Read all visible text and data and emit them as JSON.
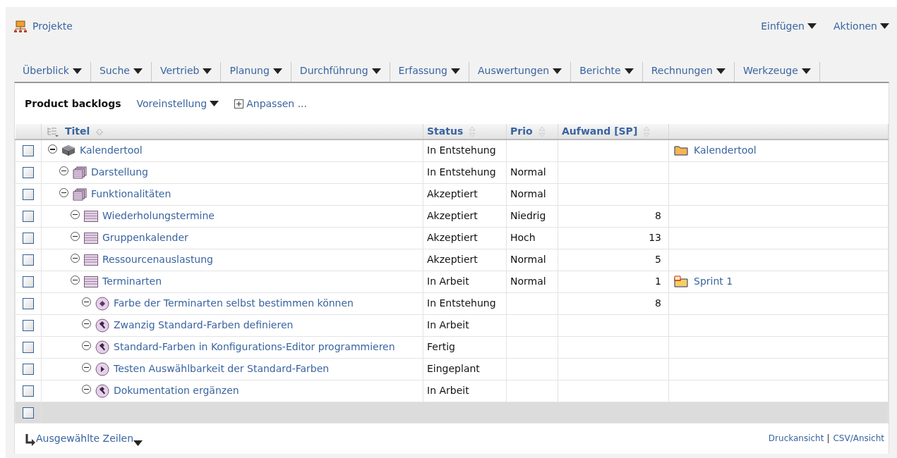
{
  "breadcrumb": {
    "label": "Projekte"
  },
  "top_actions": [
    {
      "label": "Einfügen"
    },
    {
      "label": "Aktionen"
    }
  ],
  "menu": [
    {
      "label": "Überblick"
    },
    {
      "label": "Suche"
    },
    {
      "label": "Vertrieb"
    },
    {
      "label": "Planung"
    },
    {
      "label": "Durchführung"
    },
    {
      "label": "Erfassung"
    },
    {
      "label": "Auswertungen"
    },
    {
      "label": "Berichte"
    },
    {
      "label": "Rechnungen"
    },
    {
      "label": "Werkzeuge"
    }
  ],
  "view": {
    "title": "Product backlogs",
    "preset": "Voreinstellung",
    "customize": "Anpassen ..."
  },
  "table": {
    "columns": [
      {
        "label": "Titel",
        "sorted": true
      },
      {
        "label": "Status",
        "sorted": false
      },
      {
        "label": "Prio",
        "sorted": false
      },
      {
        "label": "Aufwand [SP]",
        "sorted": false
      }
    ],
    "rows": [
      {
        "kind": "product",
        "title": "Kalendertool",
        "status": "In Entstehung",
        "checked": false,
        "expanded": true,
        "link": {
          "kind": "project",
          "label": "Kalendertool"
        },
        "children": [
          {
            "kind": "epic",
            "title": "Darstellung",
            "status": "In Entstehung",
            "prio": "Normal",
            "checked": false,
            "expanded": true
          },
          {
            "kind": "epic",
            "title": "Funktionalitäten",
            "status": "Akzeptiert",
            "prio": "Normal",
            "checked": false,
            "expanded": true,
            "children": [
              {
                "kind": "story",
                "title": "Wiederholungstermine",
                "status": "Akzeptiert",
                "prio": "Niedrig",
                "effort": "8",
                "checked": false,
                "expanded": true
              },
              {
                "kind": "story",
                "title": "Gruppenkalender",
                "status": "Akzeptiert",
                "prio": "Hoch",
                "effort": "13",
                "checked": false,
                "expanded": true
              },
              {
                "kind": "story",
                "title": "Ressourcenauslastung",
                "status": "Akzeptiert",
                "prio": "Normal",
                "effort": "5",
                "checked": false,
                "expanded": true
              },
              {
                "kind": "story",
                "title": "Terminarten",
                "status": "In Arbeit",
                "prio": "Normal",
                "effort": "1",
                "checked": false,
                "expanded": true,
                "link": {
                  "kind": "sprint",
                  "label": "Sprint 1"
                },
                "children": [
                  {
                    "kind": "spec",
                    "title": "Farbe der Terminarten selbst bestimmen können",
                    "status": "In Entstehung",
                    "effort": "8",
                    "checked": false,
                    "expanded": true
                  },
                  {
                    "kind": "work",
                    "title": "Zwanzig Standard-Farben definieren",
                    "status": "In Arbeit",
                    "checked": false,
                    "expanded": true
                  },
                  {
                    "kind": "work",
                    "title": "Standard-Farben in Konfigurations-Editor programmieren",
                    "status": "Fertig",
                    "checked": false,
                    "expanded": true
                  },
                  {
                    "kind": "test",
                    "title": "Testen Auswählbarkeit der Standard-Farben",
                    "status": "Eingeplant",
                    "checked": false,
                    "expanded": true
                  },
                  {
                    "kind": "work",
                    "title": "Dokumentation ergänzen",
                    "status": "In Arbeit",
                    "checked": false,
                    "expanded": true
                  }
                ]
              }
            ]
          }
        ]
      }
    ],
    "select_all": {
      "checked": false
    }
  },
  "footer": {
    "bulk_action": "Ausgewählte Zeilen",
    "links": [
      {
        "label": "Druckansicht"
      },
      {
        "label": "CSV/Ansicht"
      }
    ]
  }
}
